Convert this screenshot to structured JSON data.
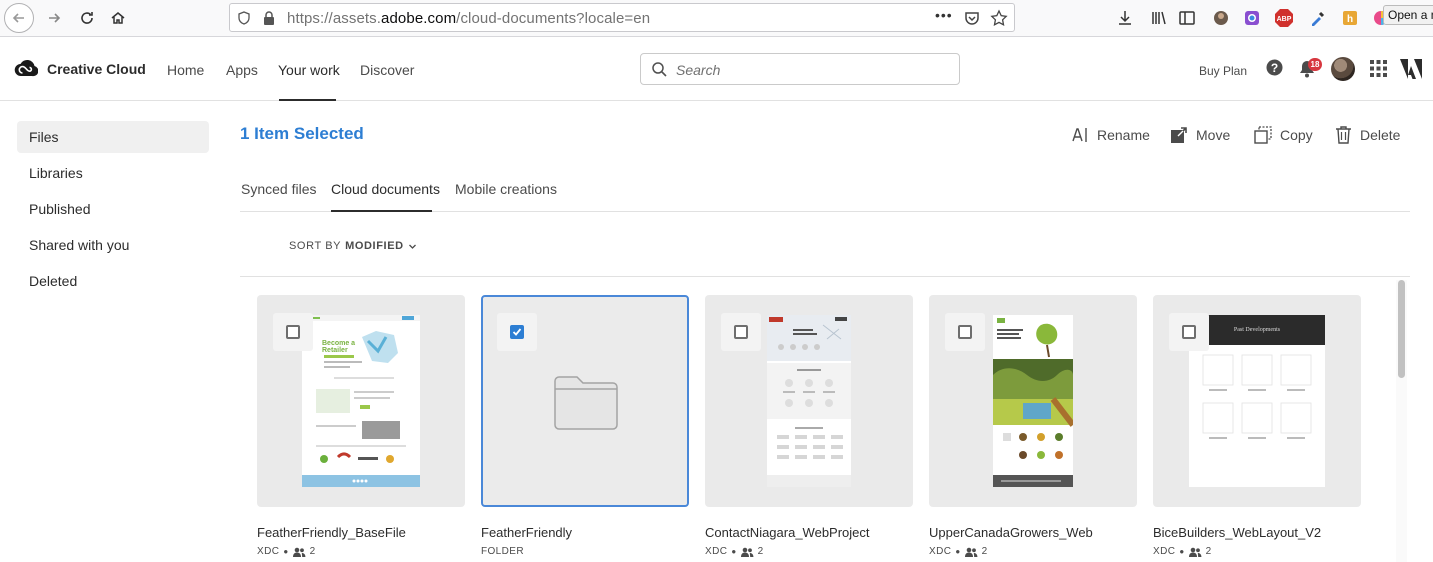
{
  "browser": {
    "url_prefix": "https://assets.",
    "url_domain": "adobe.com",
    "url_path": "/cloud-documents?locale=en",
    "page_actions": "•••",
    "tooltip": "Open a n"
  },
  "header": {
    "brand": "Creative Cloud",
    "nav": [
      "Home",
      "Apps",
      "Your work",
      "Discover"
    ],
    "active_nav": "Your work",
    "search_placeholder": "Search",
    "buy_plan": "Buy Plan",
    "notification_count": "18"
  },
  "sidebar": {
    "items": [
      {
        "label": "Files",
        "active": true
      },
      {
        "label": "Libraries",
        "active": false
      },
      {
        "label": "Published",
        "active": false
      },
      {
        "label": "Shared with you",
        "active": false
      },
      {
        "label": "Deleted",
        "active": false
      }
    ]
  },
  "main": {
    "selection_title": "1 Item Selected",
    "actions": {
      "rename": "Rename",
      "move": "Move",
      "copy": "Copy",
      "delete": "Delete"
    },
    "tabs": [
      "Synced files",
      "Cloud documents",
      "Mobile creations"
    ],
    "active_tab": "Cloud documents",
    "sort_label": "SORT BY",
    "sort_value": "MODIFIED",
    "cards": [
      {
        "name": "FeatherFriendly_BaseFile",
        "type": "XDC",
        "shared": "2",
        "selected": false,
        "thumb": "xd-retailer"
      },
      {
        "name": "FeatherFriendly",
        "type": "FOLDER",
        "shared": "",
        "selected": true,
        "thumb": "folder"
      },
      {
        "name": "ContactNiagara_WebProject",
        "type": "XDC",
        "shared": "2",
        "selected": false,
        "thumb": "xd-niagara"
      },
      {
        "name": "UpperCanadaGrowers_Web",
        "type": "XDC",
        "shared": "2",
        "selected": false,
        "thumb": "xd-growers"
      },
      {
        "name": "BiceBuilders_WebLayout_V2",
        "type": "XDC",
        "shared": "2",
        "selected": false,
        "thumb": "xd-bice"
      }
    ],
    "thumb_text": {
      "retailer_heading": "Become a Retailer",
      "bice_banner": "Past Developments"
    }
  },
  "colors": {
    "accent": "#2d7ed3",
    "selected_border": "#4a88d8",
    "badge": "#d7373f"
  }
}
